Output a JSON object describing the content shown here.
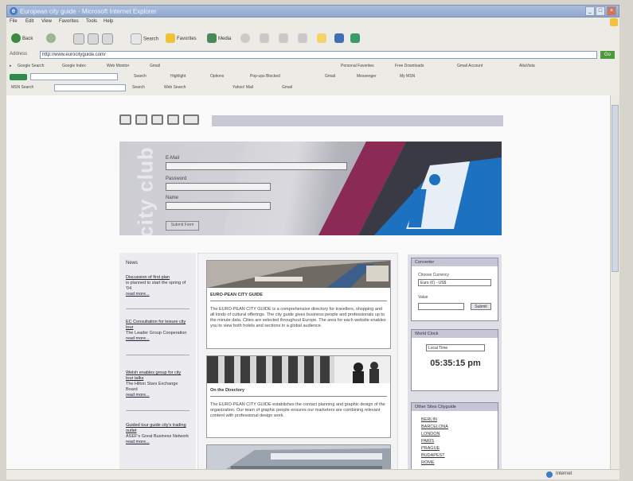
{
  "window": {
    "title": "European city guide - Microsoft Internet Explorer",
    "min_label": "_",
    "max_label": "□",
    "close_label": "×"
  },
  "menu": [
    "File",
    "Edit",
    "View",
    "Favorites",
    "Tools",
    "Help"
  ],
  "toolbar": {
    "back": "Back",
    "search": "Search",
    "favorites": "Favorites",
    "media": "Media"
  },
  "address": {
    "label": "Address",
    "value": "http://www.eurocityguide.com/",
    "go": "Go"
  },
  "links": [
    "Google Search",
    "Google Index",
    "Web Monitor",
    "Gmail",
    "Personal Favorites",
    "Free Downloads",
    "Gmail Account",
    "AltaVista"
  ],
  "tool_row1": [
    "Search",
    "Highlight",
    "Options",
    "Pop-ups Blocked",
    "Gmail",
    "Messenger",
    "My MSN"
  ],
  "tool_row2": [
    "MSN Search",
    "Search",
    "Web Search",
    "Yahoo! Mail",
    "Gmail"
  ],
  "status": {
    "zone": "Internet"
  },
  "page": {
    "logo": "city club",
    "form": {
      "label1": "E-Mail",
      "label2": "Password",
      "label3": "Name",
      "submit": "Submit Form"
    },
    "news": {
      "heading": "News",
      "items": [
        {
          "title": "Discussion of first plan",
          "body": "is planned to start the spring of '04",
          "more": "read more..."
        },
        {
          "title": "EC Consultation for leisure city tour",
          "body": "The Leader Group Cooperation",
          "more": "read more..."
        },
        {
          "title": "Welsh enables group for city tour talks",
          "body": "The Hilton Stars Exchange Board",
          "more": "read more..."
        },
        {
          "title": "Guided tour guide city's trading outlet",
          "body": "ASEF's Great Business Network",
          "more": "read more..."
        }
      ]
    },
    "articles": [
      {
        "title": "EURO-PEAN CITY GUIDE",
        "body": "The EURO-PEAN CITY GUIDE is a comprehensive directory for travellers, shopping and all kinds of cultural offerings. The city guide gives business people and professionals up to the minute data. Cities are selected throughout Europe. The area for each website enables you to view both hotels and sections in a global audience."
      },
      {
        "title": "On the Directory",
        "body": "The EURO-PEAN CITY GUIDE establishes the contact planning and graphic design of the organization. Our team of graphic people ensures our marketers are combining relevant content with professional design work."
      }
    ],
    "converter": {
      "heading": "Converter",
      "label1": "Choose Currency",
      "select1": "Euro (€) - US$",
      "label2": "Value",
      "button": "Submit"
    },
    "clock": {
      "heading": "World Clock",
      "select": "Local Time",
      "time": "05:35:15 pm"
    },
    "sister": {
      "heading": "Other Sites Cityguide",
      "items": [
        "BERLIN",
        "BARCELONA",
        "LONDON",
        "PARIS",
        "PRAGUE",
        "BUDAPEST",
        "ROME"
      ]
    }
  }
}
